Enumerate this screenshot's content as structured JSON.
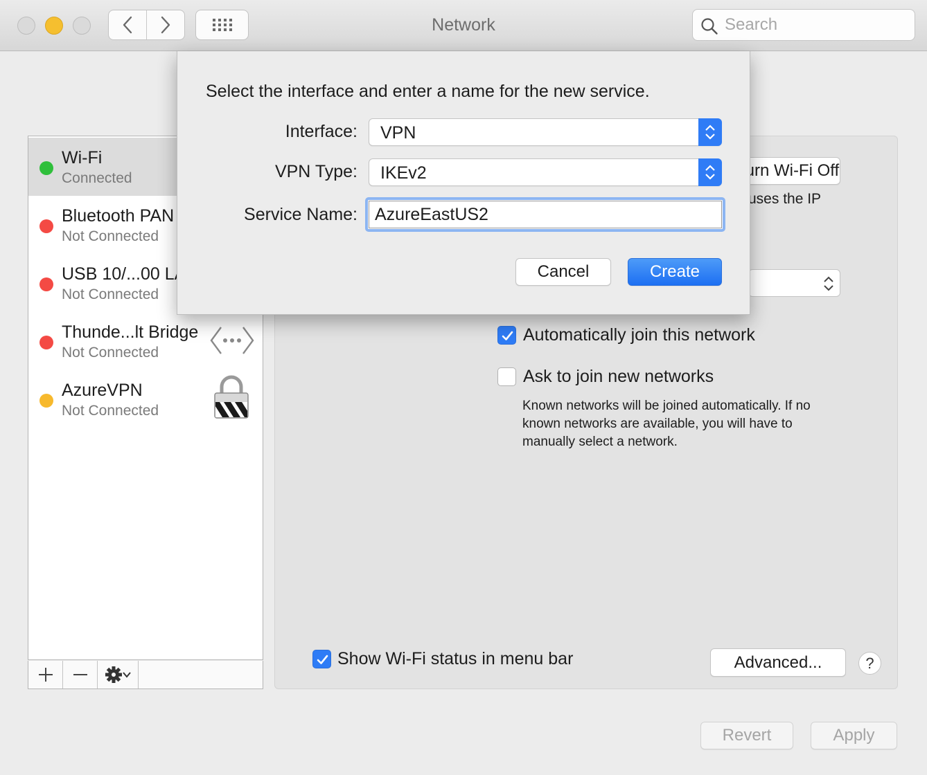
{
  "window": {
    "title": "Network",
    "search_placeholder": "Search"
  },
  "services": [
    {
      "name": "Wi-Fi",
      "status": "Connected",
      "status_color": "#2fbf3b",
      "selected": true,
      "icon": "wifi"
    },
    {
      "name": "Bluetooth PAN",
      "status": "Not Connected",
      "status_color": "#f44a44",
      "selected": false,
      "icon": "bluetooth-icon"
    },
    {
      "name": "USB 10/...00 LAN",
      "status": "Not Connected",
      "status_color": "#f44a44",
      "selected": false,
      "icon": "ethernet-icon"
    },
    {
      "name": "Thunde...lt Bridge",
      "status": "Not Connected",
      "status_color": "#f44a44",
      "selected": false,
      "icon": "thunderbolt-bridge-icon"
    },
    {
      "name": "AzureVPN",
      "status": "Not Connected",
      "status_color": "#f7b92d",
      "selected": false,
      "icon": "vpn-lock-icon"
    }
  ],
  "detail": {
    "wifi_off_label": "Turn Wi-Fi Off",
    "partial_text": "uses the IP",
    "auto_join_label": "Automatically join this network",
    "auto_join_checked": true,
    "ask_join_label": "Ask to join new networks",
    "ask_join_checked": false,
    "ask_join_hint": "Known networks will be joined automatically. If no known networks are available, you will have to manually select a network.",
    "show_status_label": "Show Wi-Fi status in menu bar",
    "show_status_checked": true,
    "advanced_label": "Advanced...",
    "help_label": "?",
    "revert_label": "Revert",
    "apply_label": "Apply"
  },
  "sheet": {
    "prompt": "Select the interface and enter a name for the new service.",
    "interface_label": "Interface:",
    "interface_value": "VPN",
    "vpn_type_label": "VPN Type:",
    "vpn_type_value": "IKEv2",
    "service_name_label": "Service Name:",
    "service_name_value": "AzureEastUS2",
    "cancel_label": "Cancel",
    "create_label": "Create"
  },
  "colors": {
    "accent": "#2e7cf6",
    "green": "#2fbf3b",
    "red": "#f44a44",
    "yellow": "#f7b92d"
  }
}
